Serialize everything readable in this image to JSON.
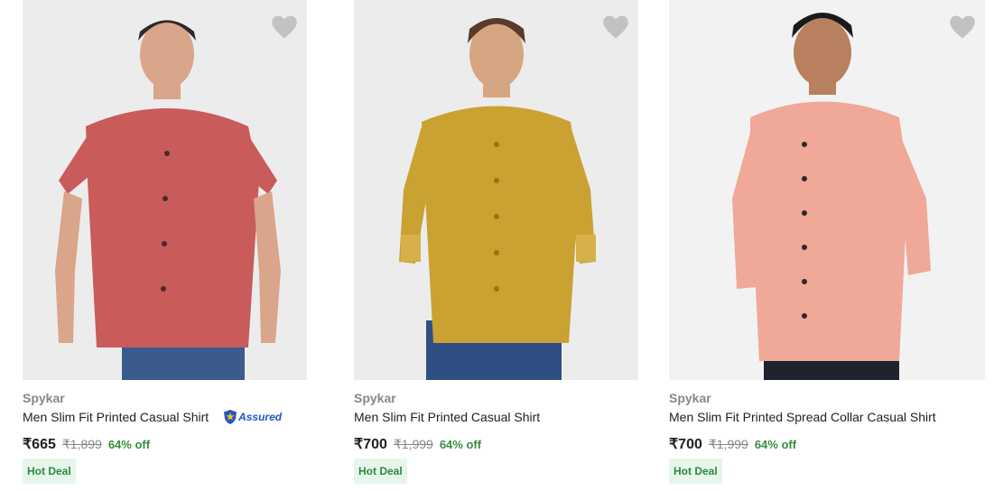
{
  "products": [
    {
      "brand": "Spykar",
      "title": "Men Slim Fit Printed Casual Shirt",
      "assured_label": "Assured",
      "price": "₹665",
      "mrp": "₹1,899",
      "discount": "64% off",
      "badge": "Hot Deal",
      "shirt_color": "#c95b5b",
      "assured": true
    },
    {
      "brand": "Spykar",
      "title": "Men Slim Fit Printed Casual Shirt",
      "price": "₹700",
      "mrp": "₹1,999",
      "discount": "64% off",
      "badge": "Hot Deal",
      "shirt_color": "#c9a232",
      "assured": false
    },
    {
      "brand": "Spykar",
      "title": "Men Slim Fit Printed Spread Collar Casual Shirt",
      "price": "₹700",
      "mrp": "₹1,999",
      "discount": "64% off",
      "badge": "Hot Deal",
      "shirt_color": "#f0a898",
      "assured": false
    }
  ],
  "colors": {
    "price_text": "#212121",
    "muted_text": "#878787",
    "discount_green": "#388e3c",
    "deal_bg": "#e7f6ea",
    "assured_blue": "#2455c4",
    "wishlist_grey": "#c2c2c2"
  },
  "icons": {
    "wishlist": "heart-icon",
    "assured": "flipkart-assured-badge"
  }
}
